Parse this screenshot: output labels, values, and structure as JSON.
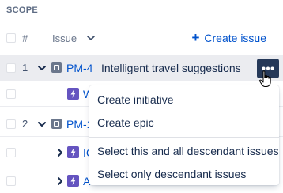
{
  "section": {
    "title": "SCOPE"
  },
  "header": {
    "number_col": "#",
    "issue_col": "Issue",
    "create_label": "Create issue"
  },
  "rows": [
    {
      "number": "1",
      "key": "PM-4",
      "summary": "Intelligent travel suggestions",
      "type_icon": "initiative-icon",
      "expanded": true
    },
    {
      "number": "",
      "key": "W",
      "summary": "",
      "type_icon": "epic-icon",
      "level": 1
    },
    {
      "number": "2",
      "key": "PM-1",
      "summary": "",
      "type_icon": "initiative-icon",
      "expanded": true
    },
    {
      "number": "",
      "key": "IC",
      "summary": "",
      "type_icon": "epic-icon",
      "level": 1
    },
    {
      "number": "",
      "key": "A",
      "summary": "",
      "type_icon": "epic-icon",
      "level": 1
    }
  ],
  "context_menu": {
    "items": [
      "Create initiative",
      "Create epic",
      "Select this and all descendant issues",
      "Select only descendant issues"
    ]
  },
  "colors": {
    "link": "#0052cc",
    "more_button_bg": "#253858",
    "selected_row_bg": "#ebecf0",
    "epic_purple": "#6554c0",
    "initiative_gray": "#6b778c"
  }
}
